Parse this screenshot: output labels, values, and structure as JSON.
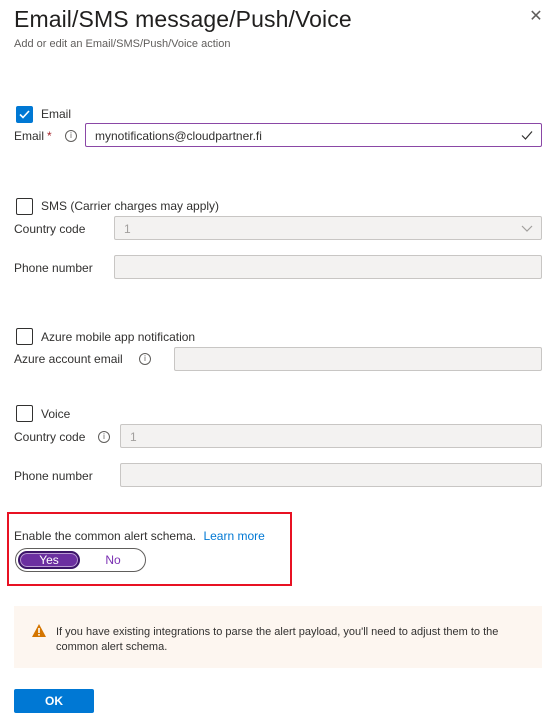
{
  "panel": {
    "title": "Email/SMS message/Push/Voice",
    "subtitle": "Add or edit an Email/SMS/Push/Voice action",
    "close_glyph": "✕"
  },
  "email": {
    "checkbox_label": "Email",
    "checked": true,
    "field_label": "Email",
    "required_mark": "*",
    "value": "mynotifications@cloudpartner.fi"
  },
  "sms": {
    "checkbox_label": "SMS (Carrier charges may apply)",
    "checked": false,
    "country_code_label": "Country code",
    "country_code_value": "1",
    "phone_label": "Phone number",
    "phone_value": ""
  },
  "push": {
    "checkbox_label": "Azure mobile app notification",
    "checked": false,
    "account_email_label": "Azure account email",
    "account_email_value": ""
  },
  "voice": {
    "checkbox_label": "Voice",
    "checked": false,
    "country_code_label": "Country code",
    "country_code_value": "1",
    "phone_label": "Phone number",
    "phone_value": ""
  },
  "schema": {
    "label": "Enable the common alert schema.",
    "learn_more": "Learn more",
    "toggle_yes": "Yes",
    "toggle_no": "No",
    "selected": "Yes"
  },
  "warning": {
    "text": "If you have existing integrations to parse the alert payload, you'll need to adjust them to the common alert schema."
  },
  "footer": {
    "ok_label": "OK"
  },
  "colors": {
    "primary": "#0078d4",
    "toggle_on": "#6b2fa0",
    "highlight_box": "#e81123",
    "warning_bg": "#fdf6f0",
    "warning_icon": "#d47500"
  }
}
